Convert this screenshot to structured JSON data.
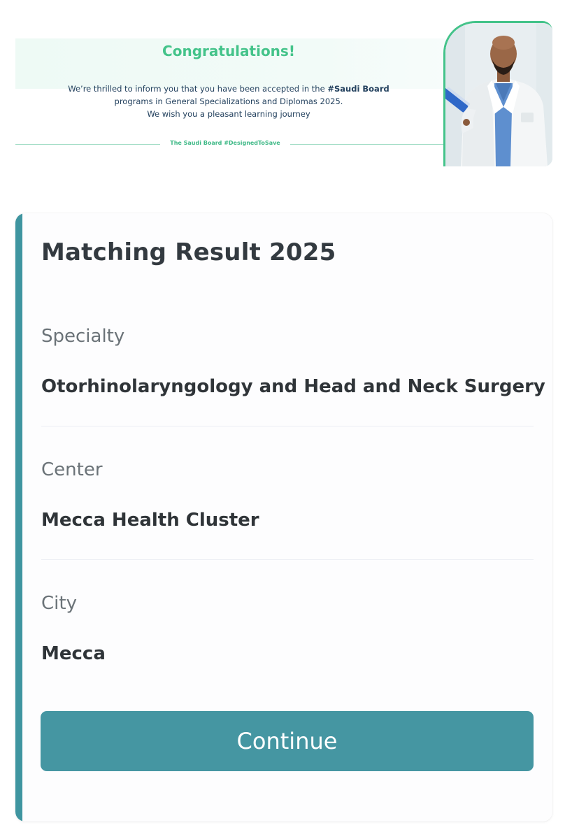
{
  "banner": {
    "title": "Congratulations!",
    "line1_prefix": "We’re thrilled to inform you that you have been accepted in the ",
    "line1_bold": "#Saudi Board",
    "line2": "programs in General Specializations and Diplomas 2025.",
    "line3": "We wish you a pleasant learning journey",
    "footer_tag": "The Saudi Board #DesignedToSave",
    "accent_color": "#44c38a"
  },
  "result": {
    "title": "Matching Result 2025",
    "fields": [
      {
        "label": "Specialty",
        "value": "Otorhinolaryngology and Head and Neck Surgery"
      },
      {
        "label": "Center",
        "value": "Mecca Health Cluster"
      },
      {
        "label": "City",
        "value": "Mecca"
      }
    ],
    "continue_label": "Continue",
    "accent_color": "#3f95a0",
    "button_color": "#4596a2"
  }
}
